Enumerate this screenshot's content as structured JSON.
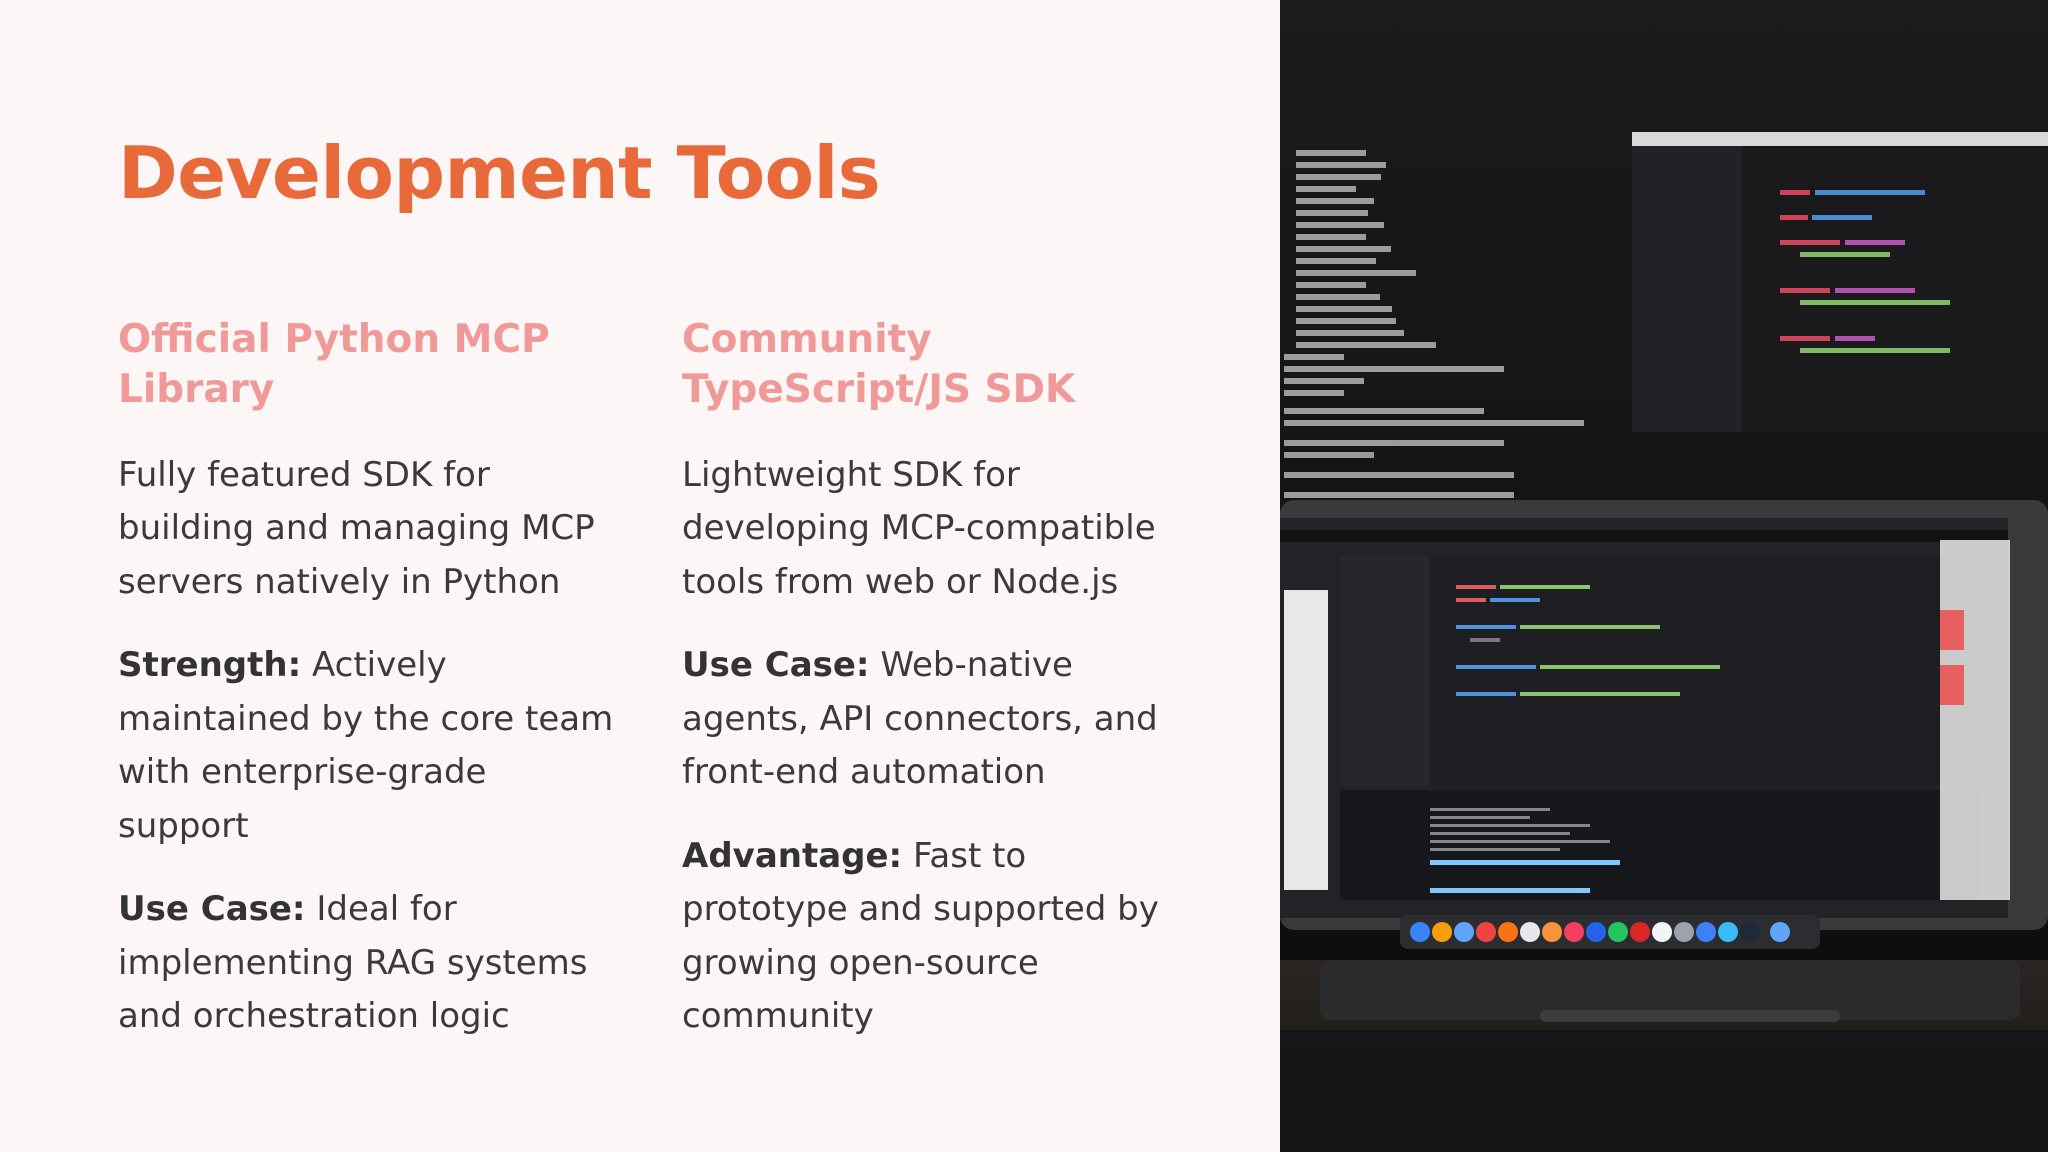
{
  "title": "Development Tools",
  "columns": [
    {
      "heading": "Official Python MCP Library",
      "description": "Fully featured SDK for building and managing MCP servers natively in Python",
      "points": [
        {
          "label": "Strength:",
          "text": " Actively maintained by the core team with enterprise-grade support"
        },
        {
          "label": "Use Case:",
          "text": " Ideal for implementing RAG systems and orchestration logic"
        }
      ]
    },
    {
      "heading": "Community TypeScript/JS SDK",
      "description": "Lightweight SDK for developing MCP-compatible tools from web or Node.js",
      "points": [
        {
          "label": "Use Case:",
          "text": " Web-native agents, API connectors, and front-end automation"
        },
        {
          "label": "Advantage:",
          "text": " Fast to prototype and supported by growing open-source community"
        }
      ]
    }
  ],
  "colors": {
    "title": "#e8693a",
    "heading": "#ef9a98",
    "body": "#3a3a3a",
    "background": "#fdf6f6"
  },
  "image": {
    "subject": "laptop-and-monitor-with-code"
  }
}
